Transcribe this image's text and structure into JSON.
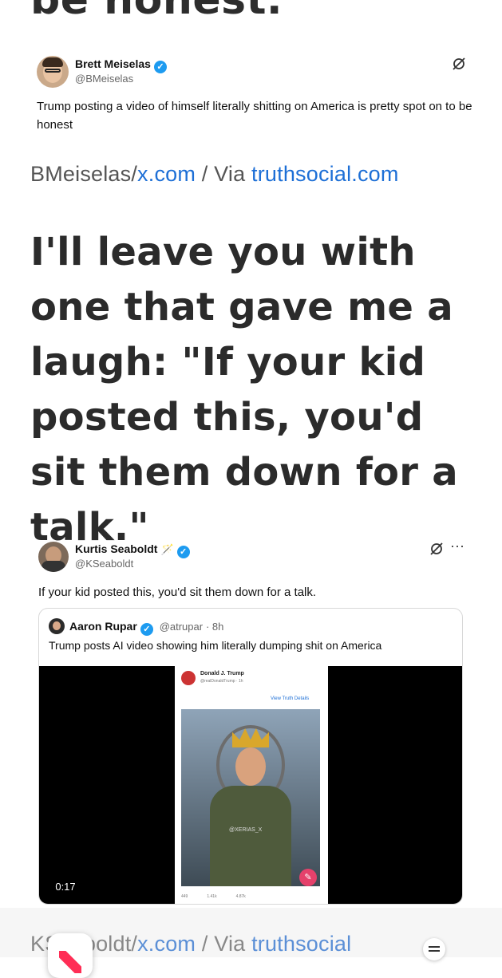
{
  "top_heading_fragment": "be honest.",
  "tweet1": {
    "name": "Brett Meiselas",
    "handle": "@BMeiselas",
    "text": "Trump posting a video of himself literally shitting on America is pretty spot on to be honest"
  },
  "credit1": {
    "source": "BMeiselas/",
    "link1": "x.com",
    "separator": " / Via ",
    "link2": "truthsocial.com"
  },
  "big_text": "I'll leave you with one that gave me a laugh: \"If your kid posted this, you'd sit them down for a talk.\"",
  "tweet2": {
    "name": "Kurtis Seaboldt",
    "handle": "@KSeaboldt",
    "text": "If your kid posted this, you'd sit them down for a talk.",
    "more": "···",
    "quote": {
      "name": "Aaron Rupar",
      "handle": "@atrupar",
      "time": "· 8h",
      "text": "Trump posts AI video showing him literally dumping shit on America",
      "video": {
        "duration": "0:17",
        "inner_name": "Donald J. Trump",
        "inner_handle": "@realDonaldTrump · 1h",
        "inner_link": "View Truth Details",
        "watermark": "@XERIAS_X",
        "stats": [
          "449",
          "1.41k",
          "4.87k"
        ]
      }
    }
  },
  "credit2": {
    "source": "KSeaboldt/",
    "link1": "x.com",
    "separator": " / Via ",
    "link2": "truthsocial"
  },
  "colors": {
    "link": "#1d6fd6",
    "verified": "#1d9bf0",
    "text": "#2b2b2b"
  }
}
